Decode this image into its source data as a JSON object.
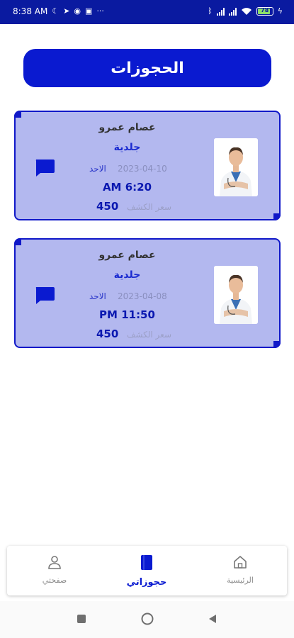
{
  "status_bar": {
    "time": "8:38 AM",
    "battery": "78",
    "icons": [
      "moon-icon",
      "telegram-icon",
      "vpn-icon",
      "notification-icon",
      "more-dots-icon",
      "bluetooth-icon",
      "signal-icon",
      "wifi-icon",
      "battery-icon",
      "charging-icon"
    ]
  },
  "header": {
    "title": "الحجوزات"
  },
  "bookings": [
    {
      "doctor_name": "عصام عمرو",
      "specialty": "جلدية",
      "day": "الاحد",
      "date": "2023-04-10",
      "time": "AM 6:20",
      "price": "450",
      "price_label": "سعر الكشف"
    },
    {
      "doctor_name": "عصام عمرو",
      "specialty": "جلدية",
      "day": "الاحد",
      "date": "2023-04-08",
      "time": "PM 11:50",
      "price": "450",
      "price_label": "سعر الكشف"
    }
  ],
  "bottom_nav": {
    "profile": "صفحتي",
    "bookings": "حجوزاتي",
    "home": "الرئيسية"
  },
  "colors": {
    "primary": "#0a1ad0",
    "card_bg": "#b3b8ef",
    "status_bar": "#0a1aa0"
  }
}
